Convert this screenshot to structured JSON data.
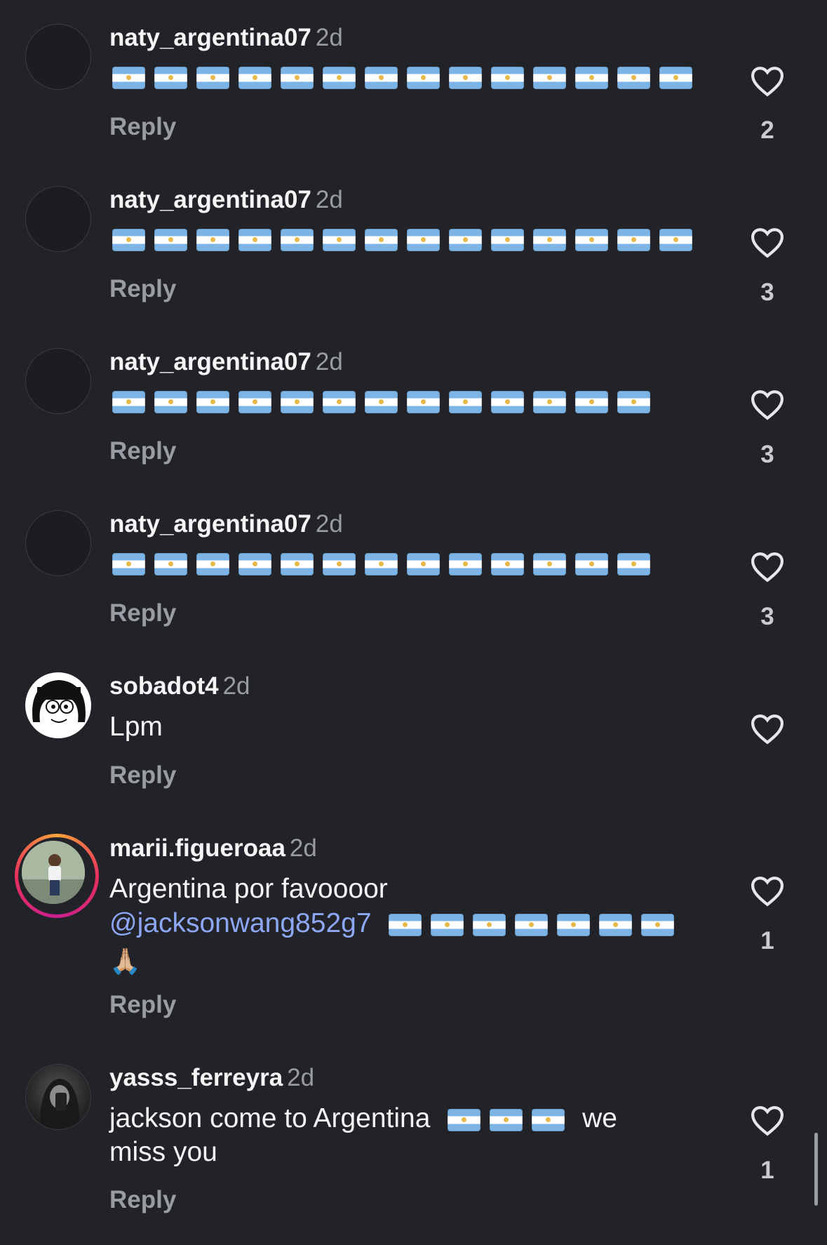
{
  "reply_label": "Reply",
  "comments": [
    {
      "username": "naty_argentina07",
      "time": "2d",
      "flag_count": 14,
      "likes": "2"
    },
    {
      "username": "naty_argentina07",
      "time": "2d",
      "flag_count": 14,
      "likes": "3"
    },
    {
      "username": "naty_argentina07",
      "time": "2d",
      "flag_count": 13,
      "likes": "3"
    },
    {
      "username": "naty_argentina07",
      "time": "2d",
      "flag_count": 13,
      "likes": "3"
    },
    {
      "username": "sobadot4",
      "time": "2d",
      "text": "Lpm",
      "likes": ""
    },
    {
      "username": "marii.figueroaa",
      "time": "2d",
      "text": "Argentina por favoooor",
      "mention": "@jacksonwang852g7",
      "flag_count": 7,
      "emoji": "🙏🏼",
      "likes": "1"
    },
    {
      "username": "yasss_ferreyra",
      "time": "2d",
      "text_before": "jackson come to Argentina",
      "flag_count": 3,
      "text_after_1": "we",
      "text_after_2": "miss you",
      "likes": "1"
    }
  ],
  "icons": {
    "like": "heart-outline-icon",
    "flag": "argentina-flag-emoji"
  },
  "colors": {
    "background": "#212328",
    "secondary_text": "#9a9ca3",
    "mention": "#8ea7f5"
  }
}
